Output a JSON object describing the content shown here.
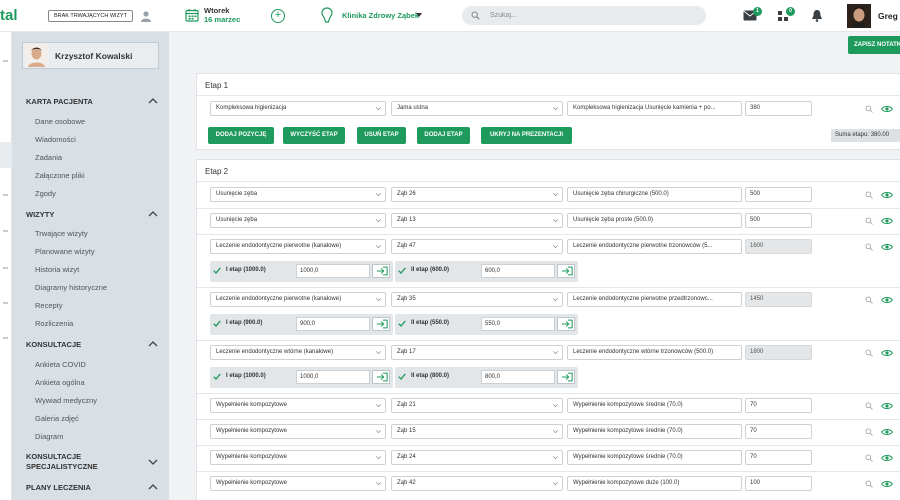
{
  "topbar": {
    "logo_text": "tal",
    "visits_button": "BRAK TRWAJĄCYCH WIZYT",
    "day_name": "Wtorek",
    "date": "16 marzec",
    "clinic": "Klinika Zdrowy Ząbek",
    "search_placeholder": "Szukaj...",
    "mail_badge": "1",
    "tasks_badge": "0",
    "user_name": "Greg"
  },
  "sidebar": {
    "patient_name": "Krzysztof Kowalski",
    "sections": [
      {
        "title": "KARTA PACJENTA",
        "items": [
          "Dane osobowe",
          "Wiadomości",
          "Zadania",
          "Załączone pliki",
          "Zgody"
        ]
      },
      {
        "title": "WIZYTY",
        "items": [
          "Trwające wizyty",
          "Planowane wizyty",
          "Historia wizyt",
          "Diagramy historyczne",
          "Recepty",
          "Rozliczenia"
        ]
      },
      {
        "title": "KONSULTACJE",
        "items": [
          "Ankieta COVID",
          "Ankieta ogólna",
          "Wywiad medyczny",
          "Galeria zdjęć",
          "Diagram"
        ]
      },
      {
        "title_line1": "KONSULTACJE",
        "title_line2": "SPECJALISTYCZNE"
      },
      {
        "title": "PLANY LECZENIA"
      }
    ]
  },
  "main": {
    "save_note": "ZAPISZ NOTATKĘ",
    "stage1": {
      "title": "Etap 1",
      "row": {
        "procedure": "Kompleksowa higienizacja",
        "location": "Jama ustna",
        "detail": "Kompleksowa higienizacja Usunięcie kamienia + po...",
        "price": "380"
      },
      "buttons": [
        "DODAJ POZYCJĘ",
        "WYCZYŚĆ ETAP",
        "USUŃ ETAP",
        "DODAJ ETAP",
        "UKRYJ NA PREZENTACJI"
      ],
      "sum": "Suma etapu: 380.00"
    },
    "stage2": {
      "title": "Etap 2",
      "rows": [
        {
          "procedure": "Usunięcie zęba",
          "tooth": "Ząb 26",
          "detail": "Usunięcie zęba chirurgiczne (500.0)",
          "price": "500"
        },
        {
          "procedure": "Usunięcie zęba",
          "tooth": "Ząb 13",
          "detail": "Usunięcie zęba proste (500.0)",
          "price": "500"
        },
        {
          "procedure": "Leczenie endodontyczne pierwotne (kanałowe)",
          "tooth": "Ząb 47",
          "detail": "Leczenie endodontyczne pierwotne trzonowców (5...",
          "price": "1600",
          "sub": [
            {
              "label": "I etap (1000.0)",
              "amount": "1000,0"
            },
            {
              "label": "II etap (600.0)",
              "amount": "600,0"
            }
          ]
        },
        {
          "procedure": "Leczenie endodontyczne pierwotne (kanałowe)",
          "tooth": "Ząb 35",
          "detail": "Leczenie endodontyczne pierwotne przedtrzonowc...",
          "price": "1450",
          "sub": [
            {
              "label": "I etap (900.0)",
              "amount": "900,0"
            },
            {
              "label": "II etap (550.0)",
              "amount": "550,0"
            }
          ]
        },
        {
          "procedure": "Leczenie endodontyczne wtórne (kanałowe)",
          "tooth": "Ząb 17",
          "detail": "Leczenie endodontyczne wtórne trzonowców (500.0)",
          "price": "1800",
          "sub": [
            {
              "label": "I etap (1000.0)",
              "amount": "1000,0"
            },
            {
              "label": "II etap (800.0)",
              "amount": "800,0"
            }
          ]
        },
        {
          "procedure": "Wypełnienie kompozytowe",
          "tooth": "Ząb 21",
          "detail": "Wypełnienie kompozytowe średnie (70.0)",
          "price": "70"
        },
        {
          "procedure": "Wypełnienie kompozytowe",
          "tooth": "Ząb 15",
          "detail": "Wypełnienie kompozytowe średnie (70.0)",
          "price": "70"
        },
        {
          "procedure": "Wypełnienie kompozytowe",
          "tooth": "Ząb 24",
          "detail": "Wypełnienie kompozytowe średnie (70.0)",
          "price": "70"
        },
        {
          "procedure": "Wypełnienie kompozytowe",
          "tooth": "Ząb 42",
          "detail": "Wypełnienie kompozytowe duże (100.0)",
          "price": "100"
        }
      ]
    }
  },
  "colors": {
    "accent": "#1e9a5c",
    "sidebar_bg": "#d8dfe5",
    "page_bg": "#f0f2f4"
  },
  "icons": [
    "calendar-icon",
    "plus-circle-icon",
    "tooth-icon",
    "search-icon",
    "mail-icon",
    "tasks-icon",
    "bell-icon",
    "magnifier-icon",
    "eye-icon",
    "check-icon",
    "arrow-in-icon",
    "chevron-up-icon",
    "chevron-down-icon"
  ]
}
